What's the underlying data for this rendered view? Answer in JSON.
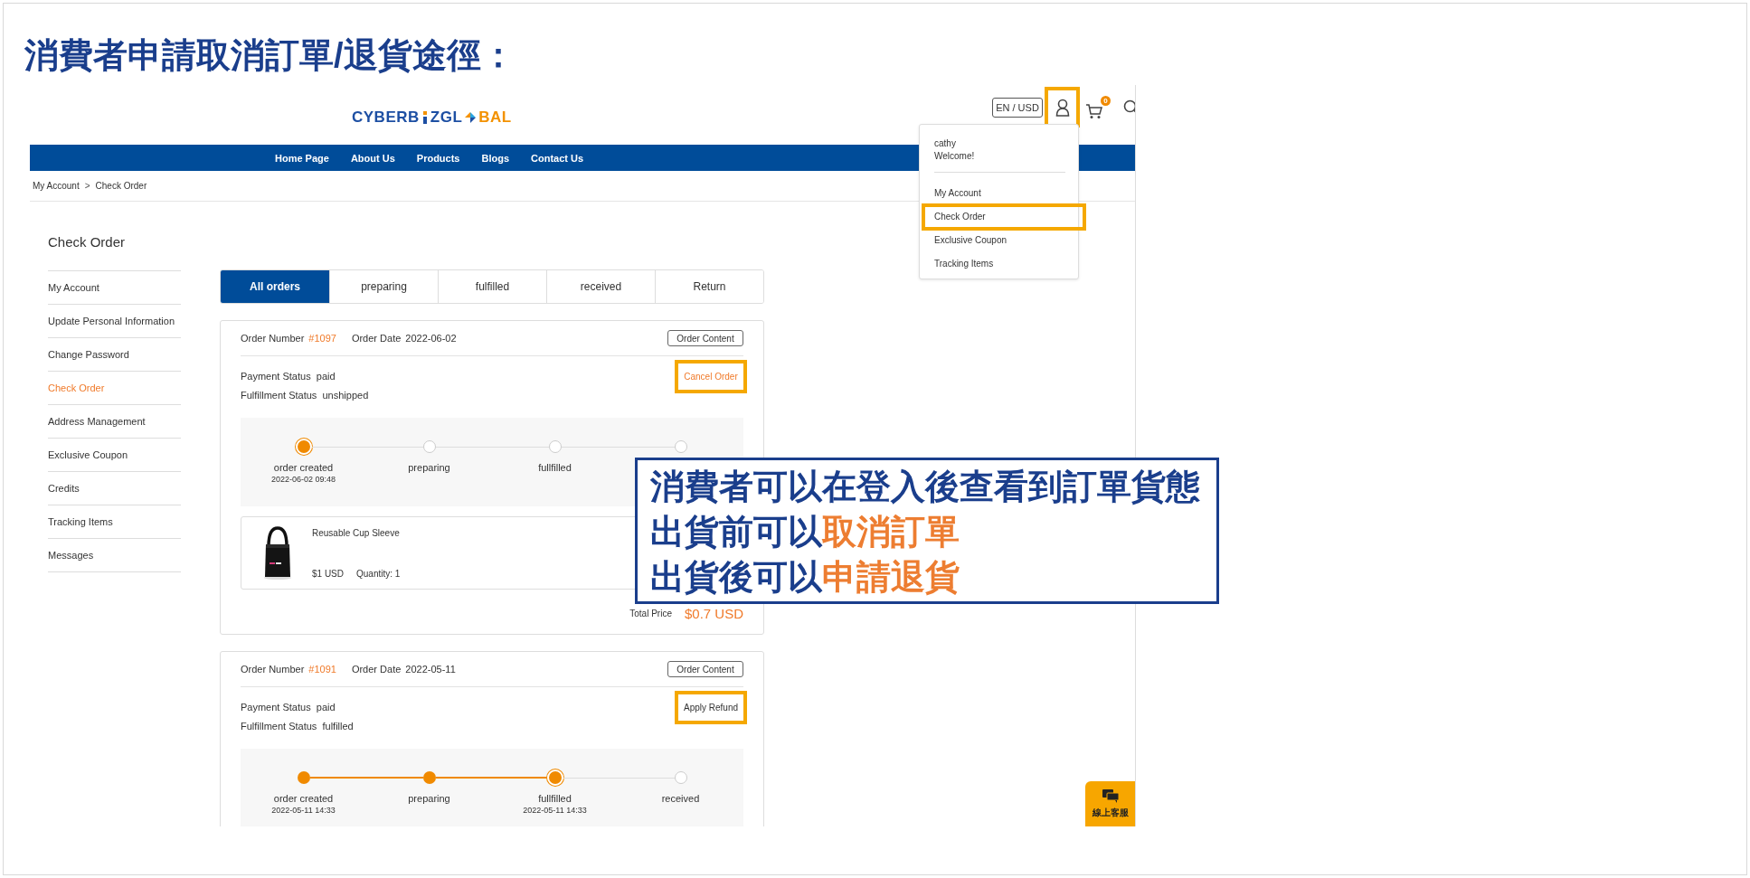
{
  "slide_title": "消費者申請取消訂單/退貨途徑：",
  "header": {
    "logo": {
      "text_1": "CYBERB",
      "text_2": "ZGL",
      "text_3": "BAL"
    },
    "currency": "EN / USD",
    "account_highlighted": true,
    "cart_count": "0"
  },
  "nav": [
    "Home Page",
    "About Us",
    "Products",
    "Blogs",
    "Contact Us"
  ],
  "breadcrumb": {
    "items": [
      "My Account",
      "Check Order"
    ],
    "separator": ">"
  },
  "account_menu": {
    "username": "cathy",
    "greeting": "Welcome!",
    "items": [
      {
        "label": "My Account",
        "highlighted": false
      },
      {
        "label": "Check Order",
        "highlighted": true
      },
      {
        "label": "Exclusive Coupon",
        "highlighted": false
      },
      {
        "label": "Tracking Items",
        "highlighted": false
      }
    ]
  },
  "page_title": "Check Order",
  "sidebar": [
    {
      "label": "My Account",
      "selected": false
    },
    {
      "label": "Update Personal Information",
      "selected": false
    },
    {
      "label": "Change Password",
      "selected": false
    },
    {
      "label": "Check Order",
      "selected": true
    },
    {
      "label": "Address Management",
      "selected": false
    },
    {
      "label": "Exclusive Coupon",
      "selected": false
    },
    {
      "label": "Credits",
      "selected": false
    },
    {
      "label": "Tracking Items",
      "selected": false
    },
    {
      "label": "Messages",
      "selected": false
    }
  ],
  "tabs": [
    {
      "label": "All orders",
      "selected": true
    },
    {
      "label": "preparing",
      "selected": false
    },
    {
      "label": "fulfilled",
      "selected": false
    },
    {
      "label": "received",
      "selected": false
    },
    {
      "label": "Return",
      "selected": false
    }
  ],
  "orders": [
    {
      "number_label": "Order Number",
      "number": "#1097",
      "date_label": "Order Date",
      "date": "2022-06-02",
      "content_button": "Order Content",
      "payment_label": "Payment Status",
      "payment": "paid",
      "fulfillment_label": "Fulfillment Status",
      "fulfillment": "unshipped",
      "action": {
        "label": "Cancel Order",
        "kind": "cancel",
        "highlighted": true
      },
      "steps": [
        {
          "label": "order created",
          "time": "2022-06-02 09:48",
          "kind": "current"
        },
        {
          "label": "preparing",
          "kind": "pending"
        },
        {
          "label": "fullfilled",
          "kind": "pending"
        },
        {
          "kind": "pending"
        }
      ],
      "items": [
        {
          "name": "Reusable Cup Sleeve",
          "price": "$1 USD",
          "quantity": "Quantity: 1"
        }
      ],
      "total_label": "Total Price",
      "total": "$0.7 USD"
    },
    {
      "number_label": "Order Number",
      "number": "#1091",
      "date_label": "Order Date",
      "date": "2022-05-11",
      "content_button": "Order Content",
      "payment_label": "Payment Status",
      "payment": "paid",
      "fulfillment_label": "Fulfillment Status",
      "fulfillment": "fulfilled",
      "action": {
        "label": "Apply Refund",
        "kind": "refund",
        "highlighted": true
      },
      "steps": [
        {
          "label": "order created",
          "time": "2022-05-11 14:33",
          "kind": "done"
        },
        {
          "label": "preparing",
          "kind": "done"
        },
        {
          "label": "fullfilled",
          "time": "2022-05-11 14:33",
          "kind": "current"
        },
        {
          "label": "received",
          "kind": "pending"
        }
      ]
    }
  ],
  "callout": {
    "lines": [
      [
        {
          "text": "消費者可以在登入後查看到訂單貨態",
          "accent": false
        }
      ],
      [
        {
          "text": "出貨前可以",
          "accent": false
        },
        {
          "text": "取消訂單",
          "accent": true
        }
      ],
      [
        {
          "text": "出貨後可以",
          "accent": false
        },
        {
          "text": "申請退貨",
          "accent": true
        }
      ]
    ]
  },
  "chat": {
    "label": "線上客服"
  }
}
